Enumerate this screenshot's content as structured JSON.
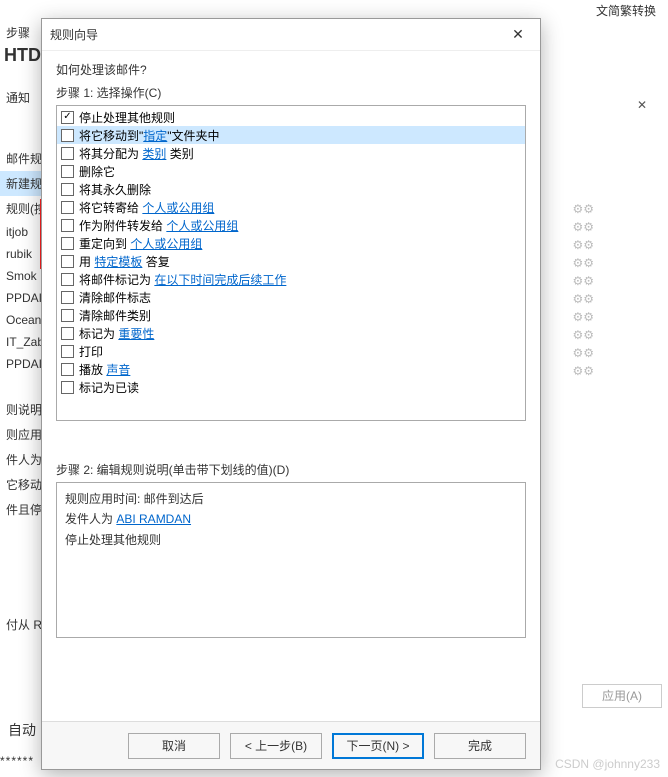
{
  "top_right": "文简繁转换",
  "background": {
    "htd": "HTD",
    "notify": "通知",
    "rules_label": "邮件规则",
    "new_rule": "新建规则",
    "rules_header": "规则(按",
    "sidebar_items": [
      "itjob",
      "rubik",
      "Smok",
      "PPDAI",
      "Ocean",
      "IT_Zab",
      "PPDAI"
    ],
    "desc_label": "则说明(单",
    "apply_label": "则应用时",
    "sender_label": "件人为",
    "move_label": "它移动到",
    "stop_label": "件且停止",
    "rss_label": "付从 RSS",
    "auto_label": "自动",
    "stars": "******",
    "apply_btn": "应用(A)",
    "close_icon": "✕"
  },
  "dialog": {
    "title": "规则向导",
    "question": "如何处理该邮件?",
    "step1_label": "步骤 1: 选择操作(C)",
    "actions": [
      {
        "checked": true,
        "text": "停止处理其他规则"
      },
      {
        "checked": false,
        "text_parts": [
          "将它移动到\"",
          {
            "link": "指定"
          },
          "\"文件夹中"
        ],
        "selected": true
      },
      {
        "checked": false,
        "text_parts": [
          "将其分配为 ",
          {
            "link": "类别"
          },
          " 类别"
        ]
      },
      {
        "checked": false,
        "text": "删除它"
      },
      {
        "checked": false,
        "text": "将其永久删除"
      },
      {
        "checked": false,
        "text_parts": [
          "将它转寄给 ",
          {
            "link": "个人或公用组"
          }
        ]
      },
      {
        "checked": false,
        "text_parts": [
          "作为附件转发给 ",
          {
            "link": "个人或公用组"
          }
        ]
      },
      {
        "checked": false,
        "text_parts": [
          "重定向到 ",
          {
            "link": "个人或公用组"
          }
        ]
      },
      {
        "checked": false,
        "text_parts": [
          "用 ",
          {
            "link": "特定模板"
          },
          " 答复"
        ]
      },
      {
        "checked": false,
        "text_parts": [
          "将邮件标记为 ",
          {
            "link": "在以下时间完成后续工作"
          }
        ]
      },
      {
        "checked": false,
        "text": "清除邮件标志"
      },
      {
        "checked": false,
        "text": "清除邮件类别"
      },
      {
        "checked": false,
        "text_parts": [
          "标记为 ",
          {
            "link": "重要性"
          }
        ]
      },
      {
        "checked": false,
        "text": "打印"
      },
      {
        "checked": false,
        "text_parts": [
          "播放 ",
          {
            "link": "声音"
          }
        ]
      },
      {
        "checked": false,
        "text": "标记为已读"
      }
    ],
    "step2_label": "步骤 2: 编辑规则说明(单击带下划线的值)(D)",
    "desc": {
      "line1": "规则应用时间: 邮件到达后",
      "line2_prefix": "发件人为 ",
      "line2_link": "ABI RAMDAN",
      "line3": "停止处理其他规则"
    },
    "buttons": {
      "cancel": "取消",
      "back": "< 上一步(B)",
      "next": "下一页(N) >",
      "finish": "完成"
    }
  },
  "watermark": "CSDN @johnny233"
}
